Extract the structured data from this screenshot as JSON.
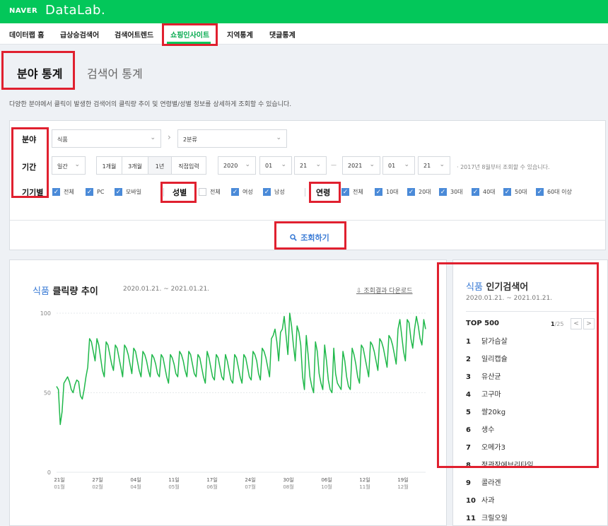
{
  "brand": {
    "naver": "NAVER",
    "datalab": "DataLab."
  },
  "gnb": [
    "데이터랩 홈",
    "급상승검색어",
    "검색어트렌드",
    "쇼핑인사이트",
    "지역통계",
    "댓글통계"
  ],
  "subtabs": {
    "field": "분야 통계",
    "keyword": "검색어 통계"
  },
  "description": "다양한 분야에서 클릭이 발생한 검색어의 클릭량 추이 및 연령별/성별 정보를 상세하게 조회할 수 있습니다.",
  "filters": {
    "field_label": "분야",
    "category1": "식품",
    "category2": "2분류",
    "period_label": "기간",
    "period_unit": "일간",
    "period_buttons": [
      "1개월",
      "3개월",
      "1년",
      "직접입력"
    ],
    "start": {
      "year": "2020",
      "month": "01",
      "day": "21"
    },
    "range_sep": "—",
    "end": {
      "year": "2021",
      "month": "01",
      "day": "21"
    },
    "period_note": "· 2017년 8월부터 조회할 수 있습니다.",
    "device_label": "기기별",
    "devices": [
      "전체",
      "PC",
      "모바일"
    ],
    "gender_label": "성별",
    "genders": [
      "전체",
      "여성",
      "남성"
    ],
    "age_label": "연령",
    "ages": [
      "전체",
      "10대",
      "20대",
      "30대",
      "40대",
      "50대",
      "60대 이상"
    ],
    "search_button": "조회하기"
  },
  "chart": {
    "category": "식품",
    "title": "클릭량 추이",
    "range": "2020.01.21. ~ 2021.01.21.",
    "download": "⇩ 조회결과 다운로드"
  },
  "chart_data": {
    "type": "line",
    "y_ticks": [
      0,
      50,
      100
    ],
    "ylim": [
      0,
      100
    ],
    "x_ticks": [
      {
        "day": "21일",
        "month": "01월"
      },
      {
        "day": "27일",
        "month": "02월"
      },
      {
        "day": "04일",
        "month": "04월"
      },
      {
        "day": "11일",
        "month": "05월"
      },
      {
        "day": "17일",
        "month": "06월"
      },
      {
        "day": "24일",
        "month": "07월"
      },
      {
        "day": "30일",
        "month": "08월"
      },
      {
        "day": "06일",
        "month": "10월"
      },
      {
        "day": "12일",
        "month": "11월"
      },
      {
        "day": "19일",
        "month": "12월"
      }
    ],
    "color": "#1fb84a",
    "series": [
      {
        "values": [
          54,
          52,
          30,
          38,
          56,
          58,
          60,
          57,
          52,
          50,
          55,
          58,
          57,
          48,
          46,
          52,
          60,
          66,
          84,
          82,
          76,
          70,
          84,
          80,
          72,
          64,
          60,
          82,
          80,
          74,
          68,
          64,
          80,
          78,
          72,
          66,
          60,
          80,
          78,
          74,
          68,
          62,
          78,
          76,
          70,
          64,
          60,
          76,
          74,
          70,
          64,
          60,
          74,
          72,
          68,
          62,
          60,
          74,
          72,
          66,
          60,
          56,
          74,
          72,
          68,
          62,
          60,
          76,
          74,
          70,
          64,
          60,
          76,
          74,
          68,
          62,
          60,
          74,
          72,
          66,
          60,
          56,
          76,
          72,
          66,
          60,
          58,
          74,
          72,
          66,
          60,
          58,
          74,
          70,
          64,
          58,
          56,
          74,
          72,
          66,
          60,
          56,
          74,
          72,
          66,
          60,
          58,
          76,
          74,
          70,
          62,
          58,
          78,
          76,
          72,
          66,
          60,
          84,
          86,
          90,
          82,
          70,
          88,
          90,
          98,
          86,
          74,
          100,
          92,
          80,
          70,
          92,
          88,
          80,
          60,
          52,
          86,
          74,
          60,
          54,
          50,
          82,
          76,
          62,
          56,
          52,
          80,
          70,
          58,
          52,
          50,
          78,
          62,
          56,
          54,
          52,
          76,
          70,
          60,
          54,
          52,
          78,
          74,
          68,
          60,
          56,
          80,
          78,
          72,
          66,
          60,
          82,
          80,
          76,
          70,
          64,
          84,
          82,
          78,
          72,
          66,
          86,
          84,
          80,
          74,
          68,
          90,
          96,
          86,
          76,
          70,
          96,
          94,
          84,
          78,
          90,
          98,
          92,
          84,
          80,
          96,
          90
        ]
      }
    ]
  },
  "ranking": {
    "category": "식품",
    "title": "인기검색어",
    "range": "2020.01.21. ~ 2021.01.21.",
    "top_label": "TOP 500",
    "page_current": "1",
    "page_total": "/25",
    "prev_icon": "<",
    "next_icon": ">",
    "items": [
      {
        "rank": "1",
        "keyword": "닭가슴살"
      },
      {
        "rank": "2",
        "keyword": "일리캡슐"
      },
      {
        "rank": "3",
        "keyword": "유산균"
      },
      {
        "rank": "4",
        "keyword": "고구마"
      },
      {
        "rank": "5",
        "keyword": "쌀20kg"
      },
      {
        "rank": "6",
        "keyword": "생수"
      },
      {
        "rank": "7",
        "keyword": "오메가3"
      },
      {
        "rank": "8",
        "keyword": "정관장에브리타임"
      },
      {
        "rank": "9",
        "keyword": "콜라겐"
      },
      {
        "rank": "10",
        "keyword": "사과"
      },
      {
        "rank": "11",
        "keyword": "크릴오일"
      }
    ]
  }
}
